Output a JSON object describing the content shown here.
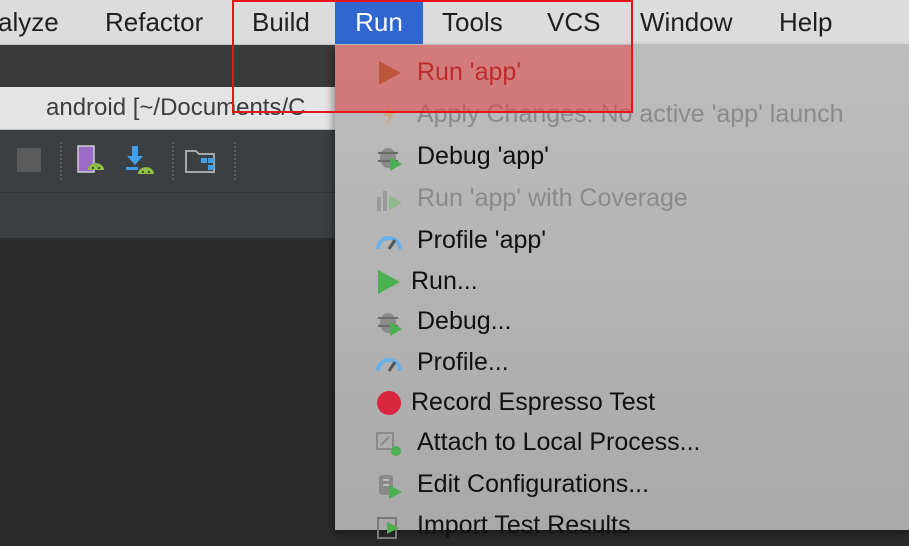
{
  "menubar": {
    "items": [
      "alyze",
      "Refactor",
      "Build",
      "Run",
      "Tools",
      "VCS",
      "Window",
      "Help"
    ],
    "active": "Run"
  },
  "ide": {
    "window_title": "android [~/Documents/C"
  },
  "run_menu": {
    "items": [
      {
        "label": "Run 'app'",
        "icon": "run-triangle-icon",
        "state": "highlighted"
      },
      {
        "label": "Apply Changes: No active 'app' launch",
        "icon": "apply-changes-icon",
        "state": "disabled"
      },
      {
        "label": "Debug 'app'",
        "icon": "debug-bug-icon",
        "state": "enabled"
      },
      {
        "label": "Run 'app' with Coverage",
        "icon": "coverage-icon",
        "state": "disabled"
      },
      {
        "label": "Profile 'app'",
        "icon": "profile-gauge-icon",
        "state": "enabled"
      },
      {
        "label": "Run...",
        "icon": "run-triangle-icon",
        "state": "enabled"
      },
      {
        "label": "Debug...",
        "icon": "debug-bug-icon",
        "state": "enabled"
      },
      {
        "label": "Profile...",
        "icon": "profile-gauge-icon",
        "state": "enabled"
      },
      {
        "label": "Record Espresso Test",
        "icon": "record-icon",
        "state": "enabled"
      },
      {
        "label": "Attach to Local Process...",
        "icon": "attach-process-icon",
        "state": "enabled"
      },
      {
        "label": "Edit Configurations...",
        "icon": "edit-configurations-icon",
        "state": "enabled"
      },
      {
        "label": "Import Test Results",
        "icon": "import-test-results-icon",
        "state": "enabled"
      }
    ]
  },
  "colors": {
    "menubar_active": "#2f66d0",
    "annotation_red": "#e8141a"
  }
}
